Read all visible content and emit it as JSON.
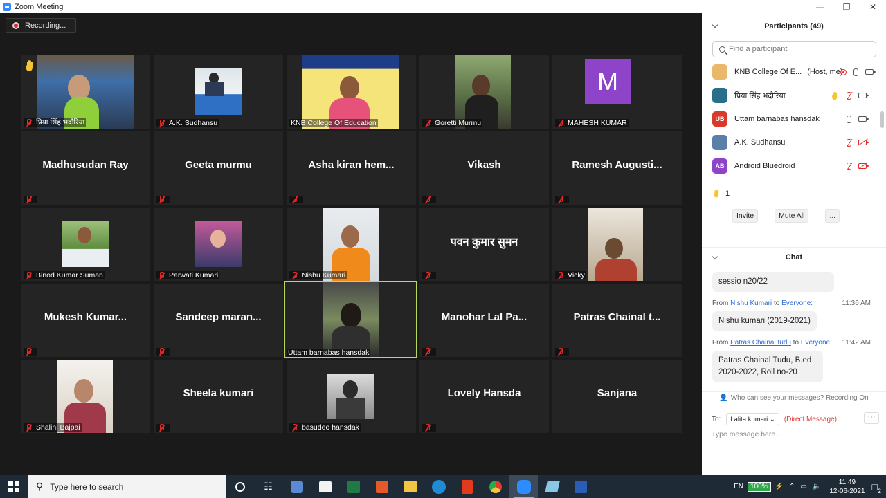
{
  "window": {
    "title": "Zoom Meeting"
  },
  "recording": {
    "label": "Recording..."
  },
  "grid": {
    "tiles": [
      {
        "name": "प्रिया सिंह भदौरिया",
        "kind": "video"
      },
      {
        "name": "A.K. Sudhansu",
        "kind": "video"
      },
      {
        "name": "KNB College Of Education",
        "kind": "video"
      },
      {
        "name": "Goretti Murmu",
        "kind": "video"
      },
      {
        "name": "MAHESH KUMAR",
        "kind": "avatar",
        "initial": "M"
      },
      {
        "big": "Madhusudan Ray"
      },
      {
        "big": "Geeta murmu"
      },
      {
        "big": "Asha kiran hem..."
      },
      {
        "big": "Vikash"
      },
      {
        "big": "Ramesh Augusti..."
      },
      {
        "name": "Binod Kumar Suman",
        "kind": "video"
      },
      {
        "name": "Parwati Kumari",
        "kind": "video"
      },
      {
        "name": "Nishu Kumari",
        "kind": "video"
      },
      {
        "big": "पवन कुमार सुमन"
      },
      {
        "name": "Vicky",
        "kind": "video"
      },
      {
        "big": "Mukesh Kumar..."
      },
      {
        "big": "Sandeep maran..."
      },
      {
        "name": "Uttam barnabas hansdak",
        "kind": "video"
      },
      {
        "big": "Manohar Lal Pa..."
      },
      {
        "big": "Patras Chainal t..."
      },
      {
        "name": "Shalini Bajpai",
        "kind": "video"
      },
      {
        "big": "Sheela kumari"
      },
      {
        "name": "basudeo hansdak",
        "kind": "video"
      },
      {
        "big": "Lovely Hansda"
      },
      {
        "big": "Sanjana"
      }
    ]
  },
  "participants": {
    "title": "Participants (49)",
    "search_placeholder": "Find a participant",
    "list": [
      {
        "name": "KNB College Of E...",
        "suffix": "(Host, me)",
        "color": "#c98a2a",
        "initials": ""
      },
      {
        "name": "प्रिया सिंह भदौरिया",
        "suffix": "",
        "color": "#2a6f8a",
        "initials": ""
      },
      {
        "name": "Uttam barnabas hansdak",
        "suffix": "",
        "color": "#d8392b",
        "initials": "UB"
      },
      {
        "name": "A.K. Sudhansu",
        "suffix": "",
        "color": "#5a7fa8",
        "initials": ""
      },
      {
        "name": "Android Bluedroid",
        "suffix": "",
        "color": "#8e44c9",
        "initials": "AB"
      }
    ],
    "raised_hands": "1",
    "invite_label": "Invite",
    "mute_all_label": "Mute All",
    "more_label": "..."
  },
  "chat": {
    "title": "Chat",
    "messages": [
      {
        "from": "",
        "to": "",
        "time": "",
        "text": "sessio n20/22"
      },
      {
        "from": "Nishu Kumari",
        "to": "Everyone:",
        "time": "11:36 AM",
        "text": "Nishu kumari (2019-2021)"
      },
      {
        "from": "Patras Chainal tudu",
        "to": "Everyone:",
        "time": "11:42 AM",
        "text": "Patras Chainal Tudu, B.ed 2020-2022, Roll no-20"
      }
    ],
    "from_word": "From",
    "to_word": "to",
    "who_can_see": "Who can see your messages? Recording On",
    "to_label": "To:",
    "to_value": "Lalita kumari",
    "direct_message": "(Direct Message)",
    "more_label": "···",
    "input_placeholder": "Type message here..."
  },
  "taskbar": {
    "search_placeholder": "Type here to search",
    "lang": "EN",
    "battery": "100%",
    "time": "11:49",
    "date": "12-06-2021",
    "notif_count": "2"
  }
}
